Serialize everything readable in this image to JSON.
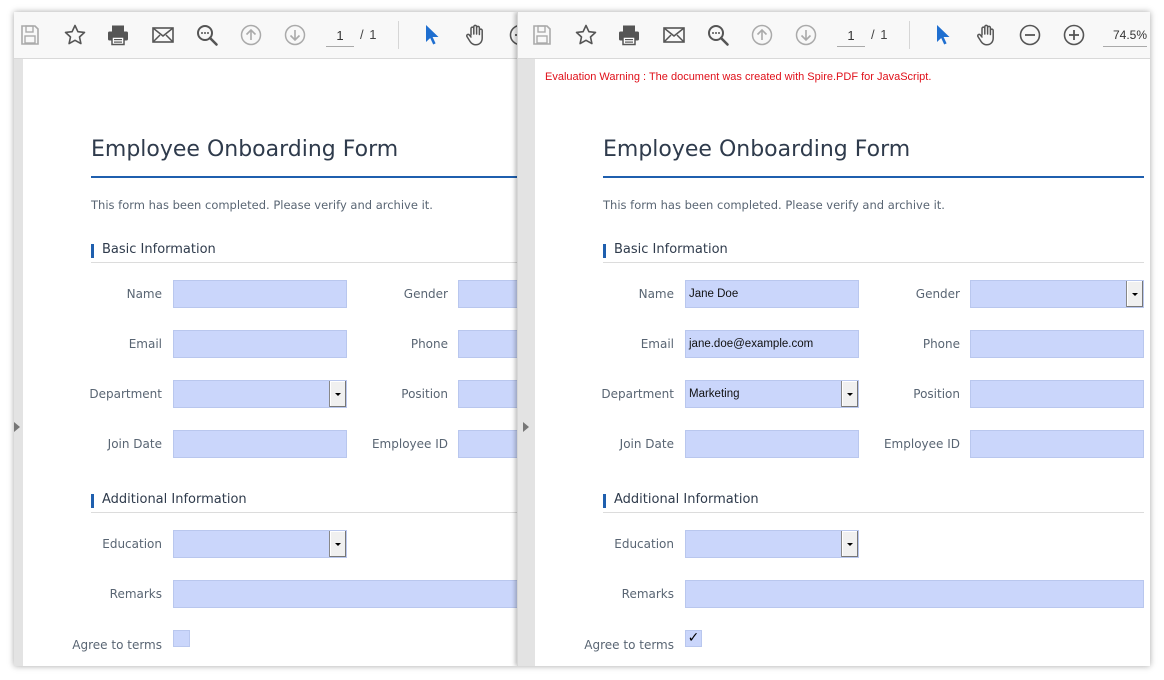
{
  "toolbar": {
    "page_current": "1",
    "page_total": "/ 1",
    "zoom": "74.5%",
    "icons": [
      "save-icon",
      "star-icon",
      "print-icon",
      "mail-icon",
      "search-icon",
      "arrow-up-icon",
      "arrow-down-icon",
      "cursor-icon",
      "hand-icon",
      "zoom-out-icon",
      "zoom-in-icon"
    ]
  },
  "warning": "Evaluation Warning : The document was created with Spire.PDF for JavaScript.",
  "form": {
    "title": "Employee Onboarding Form",
    "note": "This form has been completed. Please verify and archive it.",
    "sections": {
      "basic": "Basic Information",
      "additional": "Additional Information"
    },
    "labels": {
      "name": "Name",
      "gender": "Gender",
      "email": "Email",
      "phone": "Phone",
      "department": "Department",
      "position": "Position",
      "join_date": "Join Date",
      "employee_id": "Employee ID",
      "education": "Education",
      "remarks": "Remarks",
      "agree": "Agree to terms"
    }
  },
  "filled": {
    "name": "Jane Doe",
    "email": "jane.doe@example.com",
    "department": "Marketing",
    "agree": "✓"
  },
  "colors": {
    "accent": "#1f5fae",
    "field_fill": "#cad6fb",
    "warning": "#e0101a"
  }
}
